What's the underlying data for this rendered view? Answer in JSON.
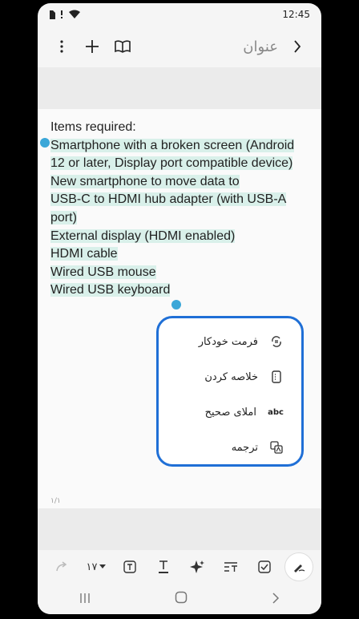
{
  "status": {
    "time": "12:45"
  },
  "header": {
    "title_placeholder": "عنوان"
  },
  "note": {
    "lines": [
      "Items required:",
      "Smartphone with a broken screen (Android",
      "12 or later, Display port compatible device)",
      "New smartphone to move data to",
      "USB-C to HDMI hub adapter (with USB-A",
      "port)",
      "External display (HDMI enabled)",
      "HDMI cable",
      "Wired USB mouse",
      "Wired USB keyboard"
    ],
    "page_indicator": "۱/۱"
  },
  "ai_menu": {
    "items": [
      {
        "label": "فرمت خودکار",
        "icon": "auto-format-icon"
      },
      {
        "label": "خلاصه کردن",
        "icon": "summarize-icon"
      },
      {
        "label": "املای صحیح",
        "icon": "spell-check-icon"
      },
      {
        "label": "ترجمه",
        "icon": "translate-icon"
      }
    ]
  },
  "toolbar": {
    "font_size": "۱۷"
  },
  "colors": {
    "accent": "#1f6fd6",
    "selection": "#d9f0ea",
    "handle": "#3ba7d8"
  }
}
